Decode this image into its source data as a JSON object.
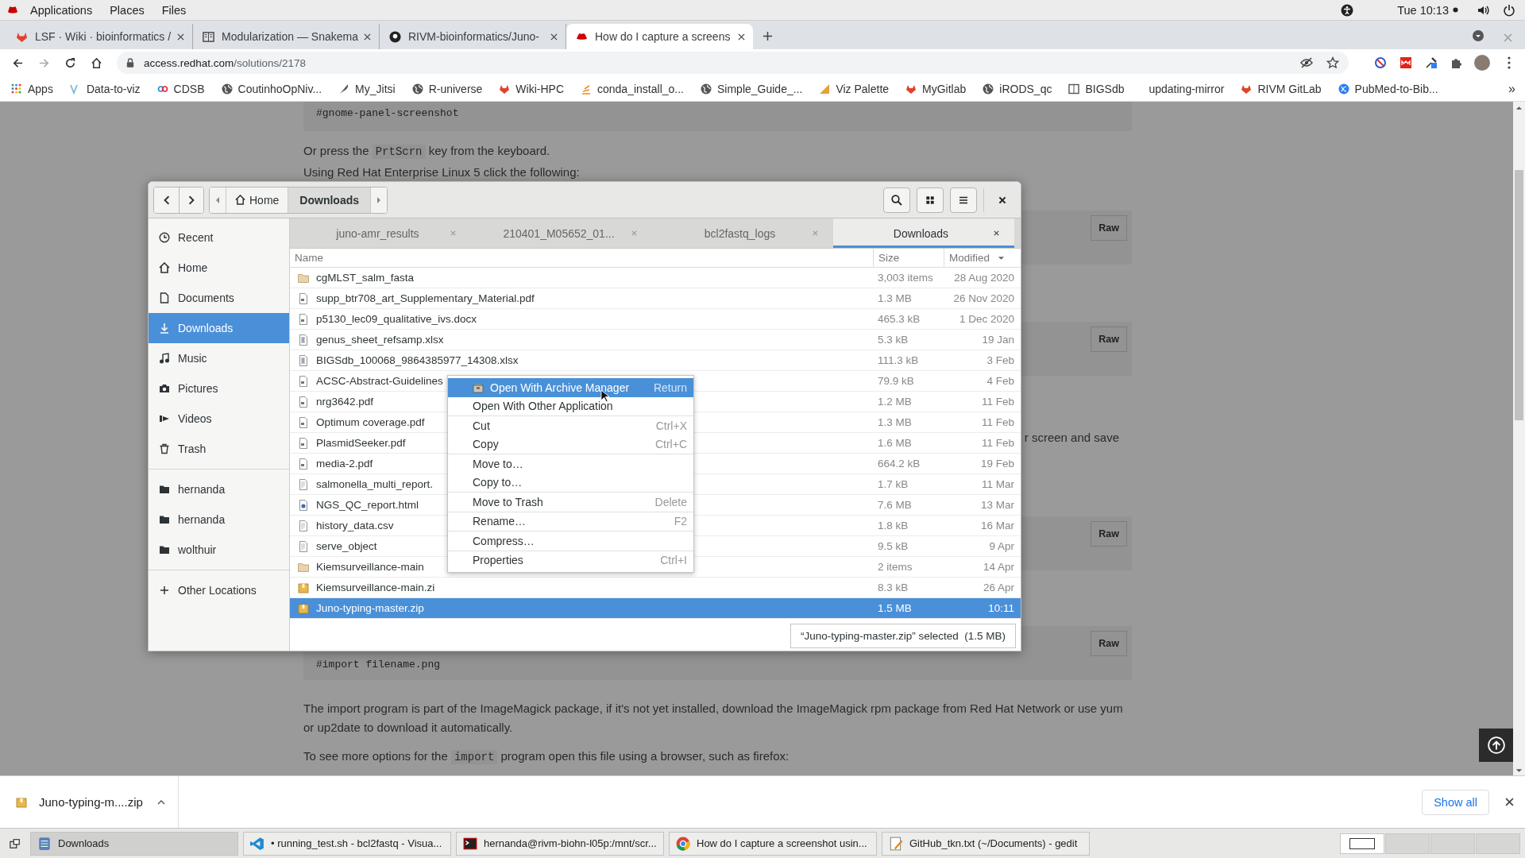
{
  "topbar": {
    "menus": [
      "Applications",
      "Places",
      "Files"
    ],
    "clock": "Tue 10:13"
  },
  "browser": {
    "tabs": [
      {
        "title": "LSF · Wiki · bioinformatics /",
        "kind": "fox",
        "selected": false
      },
      {
        "title": "Modularization — Snakema",
        "kind": "book",
        "selected": false
      },
      {
        "title": "RIVM-bioinformatics/Juno-",
        "kind": "github",
        "selected": false
      },
      {
        "title": "How do I capture a screens",
        "kind": "redhat",
        "selected": true
      }
    ],
    "forward_enabled": false,
    "url_host": "access.redhat.com",
    "url_path": "/solutions/2178",
    "bookmarks": [
      {
        "label": "Apps",
        "kind": "grid"
      },
      {
        "label": "Data-to-viz",
        "kind": "viz"
      },
      {
        "label": "CDSB",
        "kind": "links"
      },
      {
        "label": "CoutinhoOpNiv...",
        "kind": "globe"
      },
      {
        "label": "My_Jitsi",
        "kind": "feather"
      },
      {
        "label": "R-universe",
        "kind": "globe"
      },
      {
        "label": "Wiki-HPC",
        "kind": "fox"
      },
      {
        "label": "conda_install_o...",
        "kind": "stack"
      },
      {
        "label": "Simple_Guide_...",
        "kind": "globe"
      },
      {
        "label": "Viz Palette",
        "kind": "triangle"
      },
      {
        "label": "MyGitlab",
        "kind": "fox"
      },
      {
        "label": "iRODS_qc",
        "kind": "globe"
      },
      {
        "label": "BIGSdb",
        "kind": "book"
      },
      {
        "label": "updating-mirror",
        "kind": "plain"
      },
      {
        "label": "RIVM GitLab",
        "kind": "fox"
      },
      {
        "label": "PubMed-to-Bib...",
        "kind": "dna"
      }
    ],
    "more": "»"
  },
  "page": {
    "blocks": [
      {
        "kind": "code",
        "text": "#gnome-panel-screenshot"
      },
      {
        "kind": "para",
        "parts": [
          {
            "text": "Or press the "
          },
          {
            "text": "PrtScrn",
            "code": true
          },
          {
            "text": " key from the keyboard."
          }
        ]
      },
      {
        "kind": "para",
        "parts": [
          {
            "text": "Using Red Hat Enterprise Linux 5 click the following:"
          }
        ]
      },
      {
        "kind": "code",
        "raw": "Raw"
      },
      {
        "kind": "code",
        "raw": "Raw"
      },
      {
        "kind": "tail",
        "parts": [
          {
            "text": "r screen and save"
          }
        ]
      },
      {
        "kind": "code",
        "raw": "Raw"
      },
      {
        "kind": "code",
        "raw": "Raw",
        "text": "#import filename.png"
      },
      {
        "kind": "para",
        "parts": [
          {
            "text": "The import program is part of the ImageMagick package, if it's not yet installed, download the ImageMagick rpm package from Red Hat Network or use yum or up2date to download it automatically."
          }
        ]
      },
      {
        "kind": "para",
        "parts": [
          {
            "text": "To see more options for the "
          },
          {
            "text": "import",
            "code": true
          },
          {
            "text": " program open this file using a browser, such as firefox:"
          }
        ]
      }
    ]
  },
  "files": {
    "path": [
      "Home",
      "Downloads"
    ],
    "tabs": [
      {
        "label": "juno-amr_results",
        "selected": false
      },
      {
        "label": "210401_M05652_01...",
        "selected": false
      },
      {
        "label": "bcl2fastq_logs",
        "selected": false
      },
      {
        "label": "Downloads",
        "selected": true
      }
    ],
    "sidebar": {
      "places": [
        {
          "label": "Recent",
          "kind": "clock",
          "selected": false
        },
        {
          "label": "Home",
          "kind": "home",
          "selected": false
        },
        {
          "label": "Documents",
          "kind": "doc",
          "selected": false
        },
        {
          "label": "Downloads",
          "kind": "download",
          "selected": true
        },
        {
          "label": "Music",
          "kind": "music",
          "selected": false
        },
        {
          "label": "Pictures",
          "kind": "camera",
          "selected": false
        },
        {
          "label": "Videos",
          "kind": "video",
          "selected": false
        },
        {
          "label": "Trash",
          "kind": "trash",
          "selected": false
        }
      ],
      "bookmarks": [
        {
          "label": "hernanda",
          "selected": false
        },
        {
          "label": "hernanda",
          "selected": false
        },
        {
          "label": "wolthuir",
          "selected": false
        }
      ],
      "other": "Other Locations"
    },
    "columns": [
      "Name",
      "Size",
      "Modified"
    ],
    "rows": [
      {
        "name": "cgMLST_salm_fasta",
        "size": "3,003 items",
        "modified": "28 Aug 2020",
        "kind": "folder",
        "selected": false
      },
      {
        "name": "supp_btr708_art_Supplementary_Material.pdf",
        "size": "1.3 MB",
        "modified": "26 Nov 2020",
        "kind": "doc",
        "selected": false
      },
      {
        "name": "p5130_lec09_qualitative_ivs.docx",
        "size": "465.3 kB",
        "modified": "1 Dec 2020",
        "kind": "doc",
        "selected": false
      },
      {
        "name": "genus_sheet_refsamp.xlsx",
        "size": "5.3 kB",
        "modified": "19 Jan",
        "kind": "sheet",
        "selected": false
      },
      {
        "name": "BIGSdb_100068_9864385977_14308.xlsx",
        "size": "111.3 kB",
        "modified": "3 Feb",
        "kind": "sheet",
        "selected": false
      },
      {
        "name": "ACSC-Abstract-Guidelines",
        "size": "79.9 kB",
        "modified": "4 Feb",
        "kind": "doc",
        "selected": false
      },
      {
        "name": "nrg3642.pdf",
        "size": "1.2 MB",
        "modified": "11 Feb",
        "kind": "doc",
        "selected": false
      },
      {
        "name": "Optimum coverage.pdf",
        "size": "1.3 MB",
        "modified": "11 Feb",
        "kind": "doc",
        "selected": false
      },
      {
        "name": "PlasmidSeeker.pdf",
        "size": "1.6 MB",
        "modified": "11 Feb",
        "kind": "doc",
        "selected": false
      },
      {
        "name": "media-2.pdf",
        "size": "664.2 kB",
        "modified": "19 Feb",
        "kind": "doc",
        "selected": false
      },
      {
        "name": "salmonella_multi_report.",
        "size": "1.7 kB",
        "modified": "11 Mar",
        "kind": "text",
        "selected": false
      },
      {
        "name": "NGS_QC_report.html",
        "size": "7.6 MB",
        "modified": "13 Mar",
        "kind": "html",
        "selected": false
      },
      {
        "name": "history_data.csv",
        "size": "1.8 kB",
        "modified": "16 Mar",
        "kind": "text",
        "selected": false
      },
      {
        "name": "serve_object",
        "size": "9.5 kB",
        "modified": "9 Apr",
        "kind": "text",
        "selected": false
      },
      {
        "name": "Kiemsurveillance-main",
        "size": "2 items",
        "modified": "14 Apr",
        "kind": "folder",
        "selected": false
      },
      {
        "name": "Kiemsurveillance-main.zi",
        "size": "8.3 kB",
        "modified": "26 Apr",
        "kind": "zip",
        "selected": false
      },
      {
        "name": "Juno-typing-master.zip",
        "size": "1.5 MB",
        "modified": "10:11",
        "kind": "zip",
        "selected": true
      }
    ],
    "menu": [
      {
        "label": "Open With Archive Manager",
        "shortcut": "Return",
        "kind": "app",
        "selected": true,
        "group_start": false
      },
      {
        "label": "Open With Other Application",
        "kind": "plain",
        "selected": false,
        "group_start": false
      },
      {
        "label": "Cut",
        "shortcut": "Ctrl+X",
        "kind": "plain",
        "selected": false,
        "group_start": true
      },
      {
        "label": "Copy",
        "shortcut": "Ctrl+C",
        "kind": "plain",
        "selected": false,
        "group_start": false
      },
      {
        "label": "Move to…",
        "kind": "plain",
        "selected": false,
        "group_start": true
      },
      {
        "label": "Copy to…",
        "kind": "plain",
        "selected": false,
        "group_start": false
      },
      {
        "label": "Move to Trash",
        "shortcut": "Delete",
        "kind": "plain",
        "selected": false,
        "group_start": true
      },
      {
        "label": "Rename…",
        "shortcut": "F2",
        "kind": "plain",
        "selected": false,
        "group_start": true
      },
      {
        "label": "Compress…",
        "kind": "plain",
        "selected": false,
        "group_start": true
      },
      {
        "label": "Properties",
        "shortcut": "Ctrl+I",
        "kind": "plain",
        "selected": false,
        "group_start": true
      }
    ],
    "status": "“Juno-typing-master.zip” selected  (1.5 MB)"
  },
  "downloads": {
    "item": "Juno-typing-m....zip",
    "show_all": "Show all"
  },
  "taskbar": {
    "windows": [
      {
        "label": "Downloads",
        "kind": "files",
        "selected": true
      },
      {
        "label": "• running_test.sh - bcl2fastq - Visua...",
        "kind": "vscode",
        "selected": false
      },
      {
        "label": "hernanda@rivm-biohn-l05p:/mnt/scr...",
        "kind": "terminal",
        "selected": false
      },
      {
        "label": "How do I capture a screenshot usin...",
        "kind": "chrome",
        "selected": false
      },
      {
        "label": "GitHub_tkn.txt (~/Documents) - gedit",
        "kind": "gedit",
        "selected": false
      }
    ],
    "workspaces": [
      {
        "selected": true
      },
      {
        "selected": false
      },
      {
        "selected": false
      },
      {
        "selected": false
      }
    ]
  }
}
